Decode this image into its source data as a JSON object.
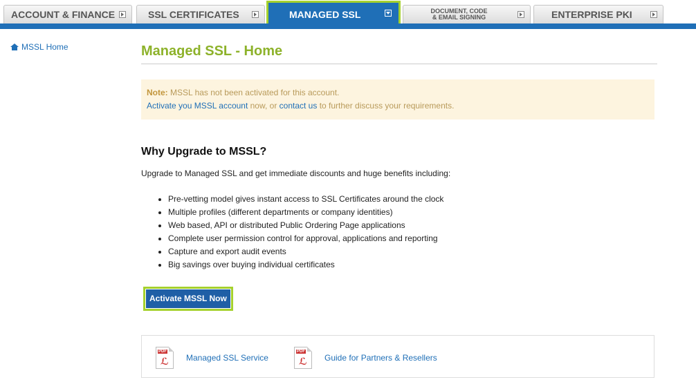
{
  "nav": {
    "tabs": [
      {
        "label": "ACCOUNT & FINANCE"
      },
      {
        "label": "SSL CERTIFICATES"
      },
      {
        "label": "MANAGED SSL"
      },
      {
        "label_line1": "DOCUMENT, CODE",
        "label_line2": "& EMAIL SIGNING"
      },
      {
        "label": "ENTERPRISE PKI"
      }
    ],
    "active_color": "#1f6fb7",
    "highlight_color": "#a5d12d"
  },
  "sidebar": {
    "home_label": "MSSL Home",
    "icon": "home-icon"
  },
  "main": {
    "title": "Managed SSL - Home",
    "note": {
      "prefix": "Note:",
      "message": " MSSL has not been activated for this account.",
      "activate_link": "Activate you MSSL account",
      "mid_text": " now, or ",
      "contact_link": "contact us",
      "suffix": " to further discuss your requirements."
    },
    "why_heading": "Why Upgrade to MSSL?",
    "intro": "Upgrade to Managed SSL and get immediate discounts and huge benefits including:",
    "benefits": [
      "Pre-vetting model gives instant access to SSL Certificates around the clock",
      "Multiple profiles (different departments or company identities)",
      "Web based, API or distributed Public Ordering Page applications",
      "Complete user permission control for approval, applications and reporting",
      "Capture and export audit events",
      "Big savings over buying individual certificates"
    ],
    "activate_button": "Activate MSSL Now"
  },
  "docs": [
    {
      "label": "Managed SSL Service",
      "icon": "pdf-icon"
    },
    {
      "label": "Guide for Partners & Resellers",
      "icon": "pdf-icon"
    }
  ]
}
